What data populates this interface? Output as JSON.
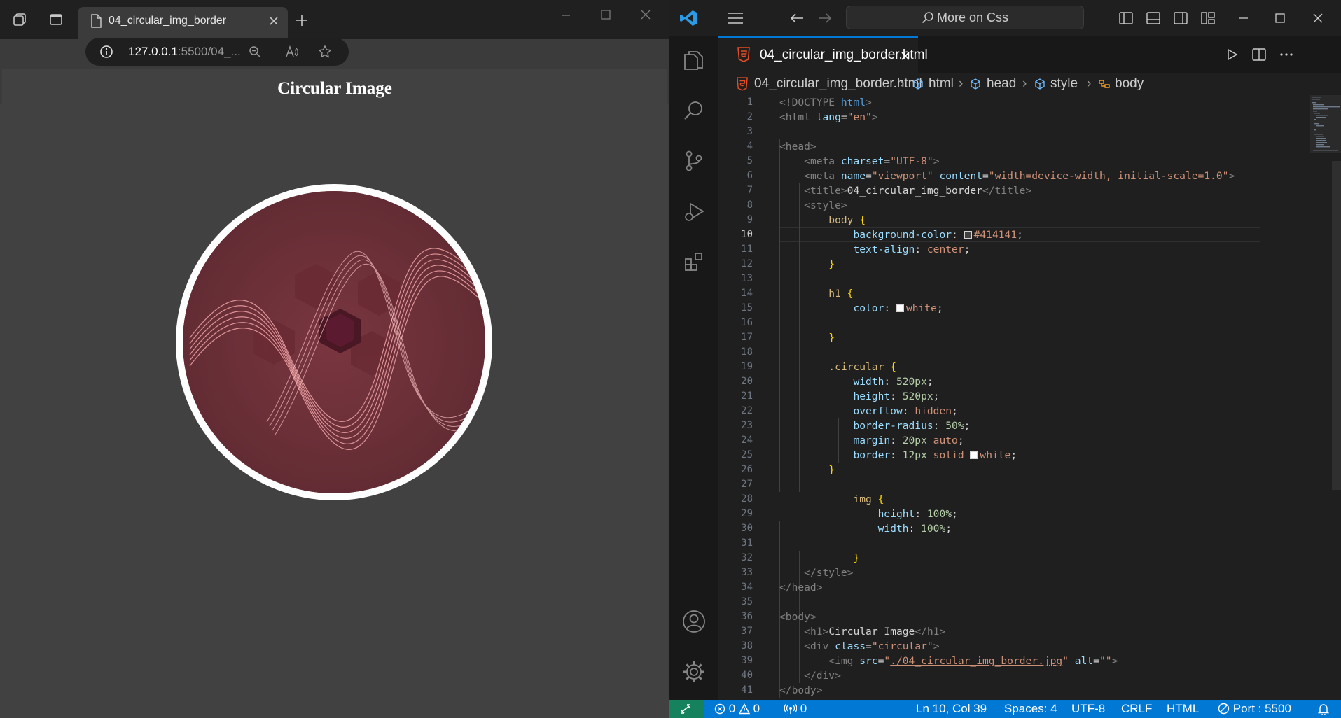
{
  "browser": {
    "tab_title": "04_circular_img_border",
    "address": {
      "host": "127.0.0.1",
      "rest": ":5500/04_..."
    },
    "page": {
      "heading": "Circular Image"
    }
  },
  "vscode": {
    "search_text": "More on Css",
    "active_tab": "04_circular_img_border.html",
    "breadcrumb": [
      "04_circular_img_border.html",
      "html",
      "head",
      "style",
      "body"
    ],
    "line_numbers": [
      "1",
      "2",
      "3",
      "4",
      "5",
      "6",
      "7",
      "8",
      "9",
      "10",
      "11",
      "12",
      "13",
      "14",
      "15",
      "16",
      "17",
      "18",
      "19",
      "20",
      "21",
      "22",
      "23",
      "24",
      "25",
      "26",
      "27",
      "28",
      "29",
      "30",
      "31",
      "32",
      "33",
      "34",
      "35",
      "36",
      "37",
      "38",
      "39",
      "40",
      "41"
    ],
    "current_line": "10",
    "code": {
      "l1": [
        "<!DOCTYPE",
        " html",
        ">"
      ],
      "l2": [
        "<html",
        " lang",
        "=",
        "\"en\"",
        ">"
      ],
      "l4": [
        "<head>"
      ],
      "l5": [
        "<meta",
        " charset",
        "=",
        "\"UTF-8\"",
        ">"
      ],
      "l6": [
        "<meta",
        " name",
        "=",
        "\"viewport\"",
        " content",
        "=",
        "\"width=device-width, initial-scale=1.0\"",
        ">"
      ],
      "l7": [
        "<title>",
        "04_circular_img_border",
        "</title>"
      ],
      "l8": [
        "<style>"
      ],
      "l9": [
        "body",
        " {"
      ],
      "l10": [
        "background-color",
        ": ",
        "#414141",
        ";"
      ],
      "l11": [
        "text-align",
        ": ",
        "center",
        ";"
      ],
      "l12": [
        "}"
      ],
      "l14": [
        "h1",
        " {"
      ],
      "l15": [
        "color",
        ": ",
        "white",
        ";"
      ],
      "l17": [
        "}"
      ],
      "l19": [
        ".circular",
        " {"
      ],
      "l20": [
        "width",
        ": ",
        "520px",
        ";"
      ],
      "l21": [
        "height",
        ": ",
        "520px",
        ";"
      ],
      "l22": [
        "overflow",
        ": ",
        "hidden",
        ";"
      ],
      "l23": [
        "border-radius",
        ": ",
        "50%",
        ";"
      ],
      "l24": [
        "margin",
        ": ",
        "20px",
        " auto",
        ";"
      ],
      "l25": [
        "border",
        ": ",
        "12px",
        " solid ",
        "white",
        ";"
      ],
      "l26": [
        "}"
      ],
      "l28": [
        "img",
        " {"
      ],
      "l29": [
        "height",
        ": ",
        "100%",
        ";"
      ],
      "l30": [
        "width",
        ": ",
        "100%",
        ";"
      ],
      "l32": [
        "}"
      ],
      "l33": [
        "</style>"
      ],
      "l34": [
        "</head>"
      ],
      "l36": [
        "<body>"
      ],
      "l37": [
        "<h1>",
        "Circular Image",
        "</h1>"
      ],
      "l38": [
        "<div",
        " class",
        "=",
        "\"circular\"",
        ">"
      ],
      "l39": [
        "<img",
        " src",
        "=",
        "\"",
        "./04_circular_img_border.jpg",
        "\"",
        " alt",
        "=",
        "\"\"",
        ">"
      ],
      "l40": [
        "</div>"
      ],
      "l41": [
        "</body>"
      ]
    },
    "status": {
      "errors": "0",
      "warnings": "0",
      "ports": "0",
      "position": "Ln 10, Col 39",
      "spaces": "Spaces: 4",
      "encoding": "UTF-8",
      "eol": "CRLF",
      "language": "HTML",
      "port": "Port : 5500"
    }
  },
  "colors": {
    "page_bg": "#414141",
    "accent": "#0078d4",
    "image_tint": "#6d2f36"
  }
}
